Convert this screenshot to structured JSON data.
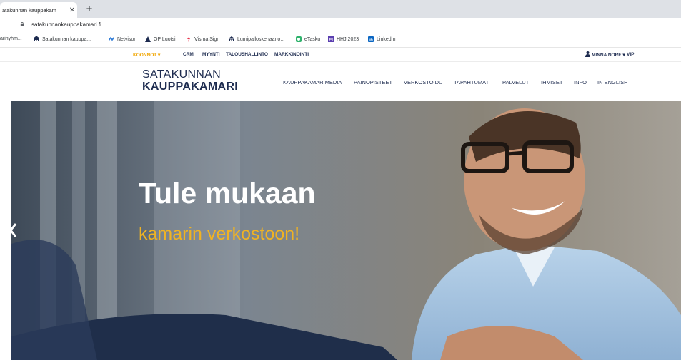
{
  "browser": {
    "tab_title": "atakunnan kauppakam",
    "url": "satakunnankauppakamari.fi",
    "bookmarks": [
      {
        "label": "arinyhm...",
        "icon": "folder-icon"
      },
      {
        "label": "Satakunnan kauppa...",
        "icon": "kauppakamari-icon"
      },
      {
        "label": "Netvisor",
        "icon": "netvisor-icon"
      },
      {
        "label": "OP Luotsi",
        "icon": "op-icon"
      },
      {
        "label": "Visma Sign",
        "icon": "visma-icon"
      },
      {
        "label": "Lumipalloskenaario...",
        "icon": "kauppakamari-icon"
      },
      {
        "label": "eTasku",
        "icon": "etasku-icon"
      },
      {
        "label": "HHJ 2023",
        "icon": "hhj-icon"
      },
      {
        "label": "LinkedIn",
        "icon": "linkedin-icon"
      }
    ]
  },
  "utility_nav": {
    "items": [
      "KOONNOT ▾",
      "CRM",
      "MYYNTI",
      "TALOUSHALLINTO",
      "MARKKINOINTI"
    ],
    "user": "MINNA NORE ▾",
    "vip": "VIP"
  },
  "header": {
    "logo_line1": "SATAKUNNAN",
    "logo_line2": "KAUPPAKAMARI",
    "nav": [
      "KAUPPAKAMARIMEDIA",
      "PAINOPISTEET",
      "VERKOSTOIDU",
      "TAPAHTUMAT",
      "PALVELUT",
      "IHMISET",
      "INFO",
      "IN ENGLISH"
    ]
  },
  "hero": {
    "title": "Tule mukaan",
    "subtitle": "kamarin verkostoon!"
  },
  "colors": {
    "brand_navy": "#1d2b4f",
    "accent_yellow": "#f0b323",
    "utility_orange": "#f0a500"
  }
}
